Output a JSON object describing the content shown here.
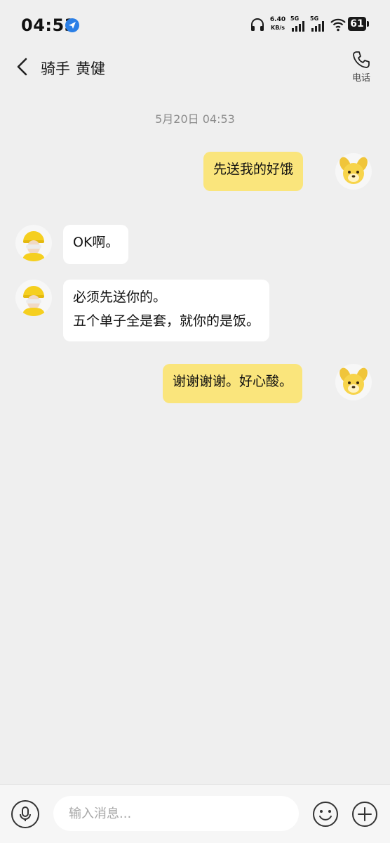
{
  "status_bar": {
    "time": "04:53",
    "net_speed_value": "6.40",
    "net_speed_unit": "KB/s",
    "signal_1_label": "5G",
    "signal_2_label": "5G",
    "battery_level": "61",
    "icons": [
      "location-arrow-icon",
      "headphone-icon",
      "signal-icon",
      "wifi-icon",
      "battery-icon"
    ]
  },
  "header": {
    "role": "骑手",
    "name": "黄健",
    "call_label": "电话",
    "icons": [
      "back-arrow-icon",
      "phone-icon"
    ]
  },
  "conversation": {
    "timestamp": "5月20日 04:53",
    "messages": [
      {
        "direction": "outgoing",
        "lines": [
          "先送我的好饿"
        ]
      },
      {
        "direction": "incoming",
        "lines": [
          "OK啊。"
        ]
      },
      {
        "direction": "incoming",
        "lines": [
          "必须先送你的。",
          "五个单子全是套，就你的是饭。"
        ]
      },
      {
        "direction": "outgoing",
        "lines": [
          "谢谢谢谢。好心酸。"
        ]
      }
    ]
  },
  "input_bar": {
    "placeholder": "输入消息...",
    "value": "",
    "icons": [
      "microphone-icon",
      "emoji-icon",
      "plus-icon"
    ]
  },
  "colors": {
    "background": "#efefef",
    "outgoing_bubble": "#fae57c",
    "incoming_bubble": "#ffffff",
    "rider_avatar_helmet": "#f5cf1f"
  }
}
